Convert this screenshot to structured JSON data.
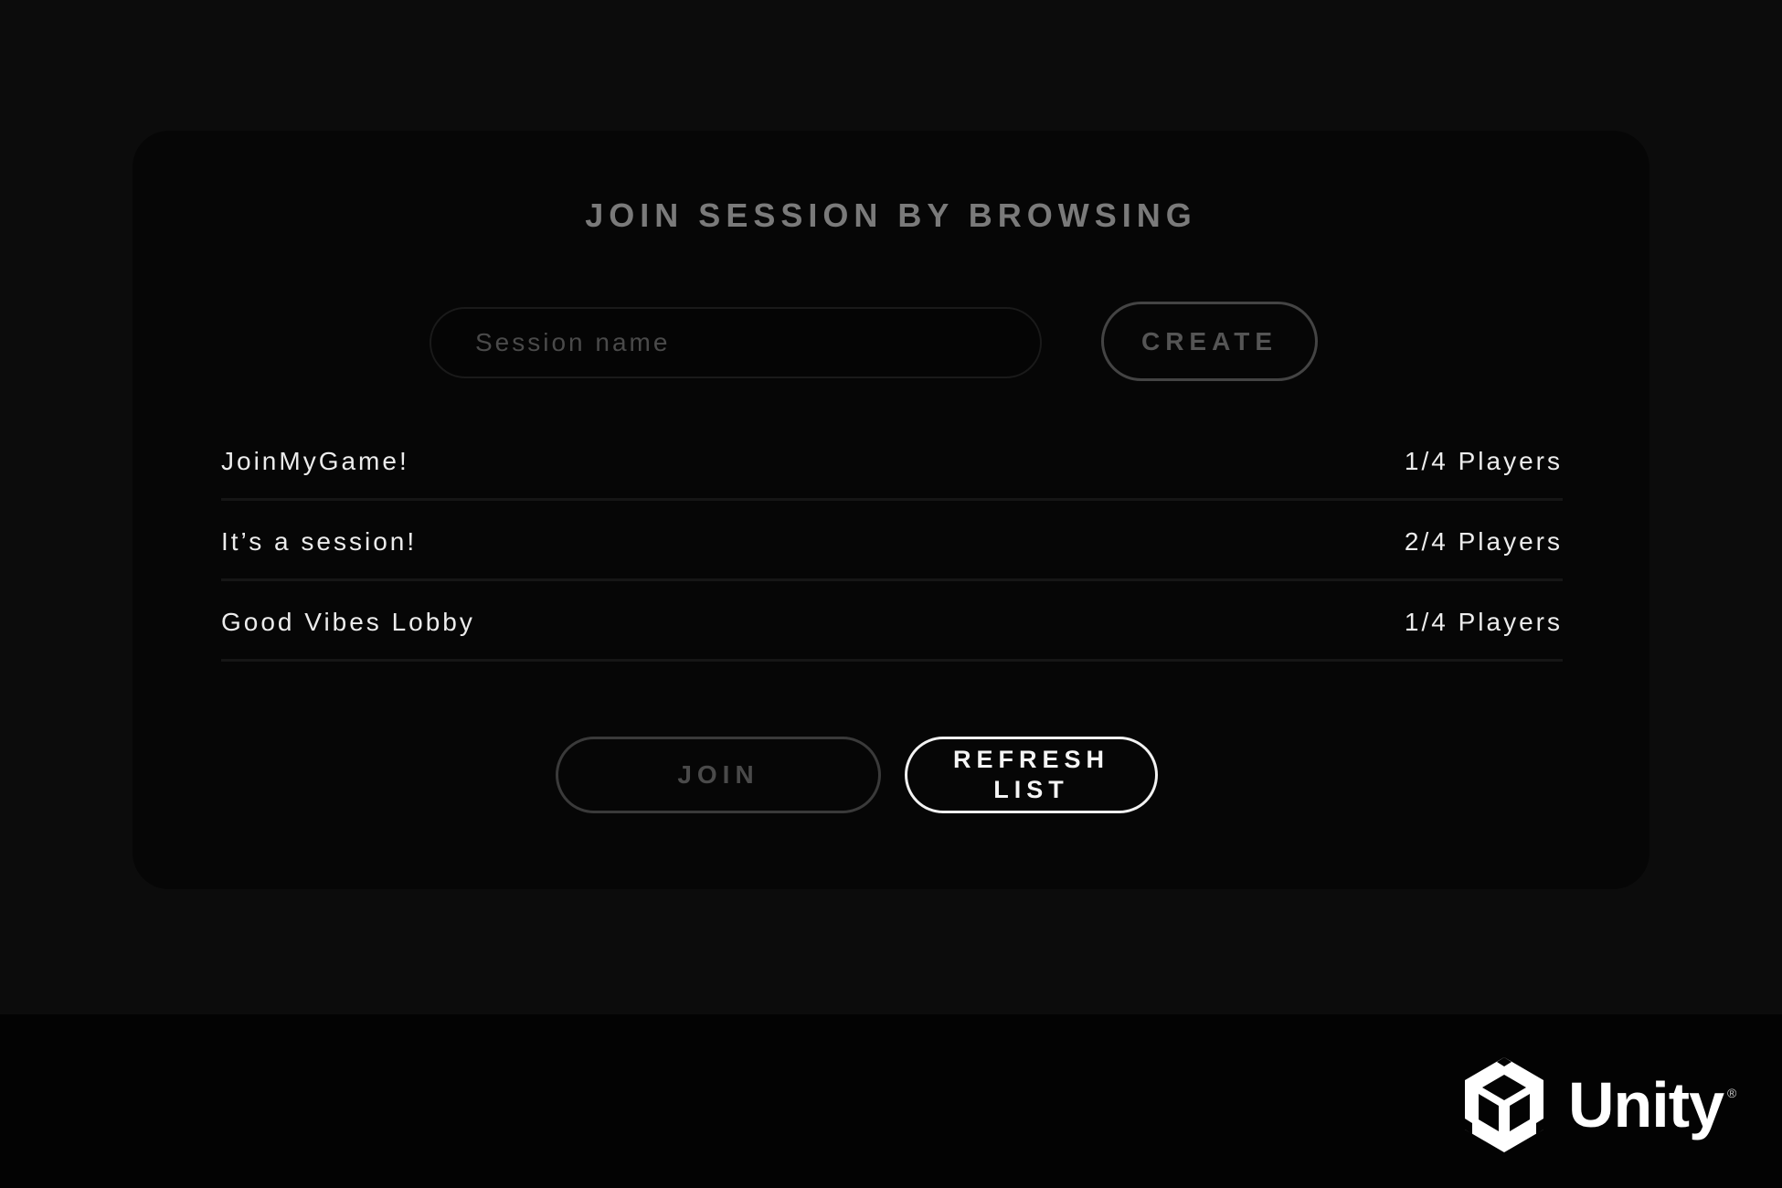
{
  "dialog": {
    "title": "JOIN SESSION BY BROWSING",
    "session_input": {
      "placeholder": "Session name",
      "value": ""
    },
    "create_label": "CREATE",
    "sessions": [
      {
        "name": "JoinMyGame!",
        "players": "1/4 Players"
      },
      {
        "name": "It’s a session!",
        "players": "2/4 Players"
      },
      {
        "name": "Good Vibes Lobby",
        "players": "1/4 Players"
      }
    ],
    "join_label": "JOIN",
    "refresh_label": "REFRESH LIST"
  },
  "brand": {
    "name": "Unity",
    "registered_symbol": "®",
    "icon": "unity-cube-icon"
  },
  "colors": {
    "background": "#0c0c0c",
    "panel": "#060606",
    "text": "#ececec",
    "muted": "#7a7a7a",
    "accent": "#f2f2f2"
  }
}
